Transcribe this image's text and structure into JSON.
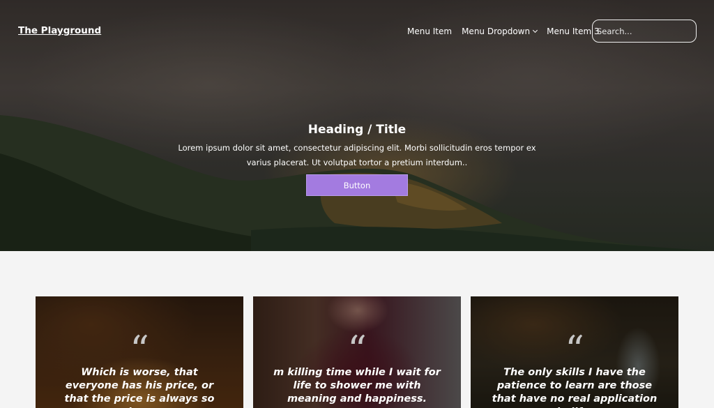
{
  "navbar": {
    "brand": "The Playground",
    "menu": [
      {
        "label": "Menu Item"
      },
      {
        "label": "Menu Dropdown",
        "has_dropdown": true
      },
      {
        "label": "Menu Item 3"
      }
    ],
    "search_placeholder": "Search..."
  },
  "hero": {
    "title": "Heading / Title",
    "text": "Lorem ipsum dolor sit amet, consectetur adipiscing elit. Morbi sollicitudin eros tempor ex varius placerat. Ut volutpat tortor a pretium interdum..",
    "button_label": "Button",
    "button_color": "#a37be0"
  },
  "quote_icon_glyph": "“",
  "cards": [
    {
      "quote": "Which is worse, that everyone has his price, or that the price is always so low."
    },
    {
      "quote": "m killing time while I wait for life to shower me with meaning and happiness."
    },
    {
      "quote": "The only skills I have the patience to learn are those that have no real application in life."
    }
  ]
}
